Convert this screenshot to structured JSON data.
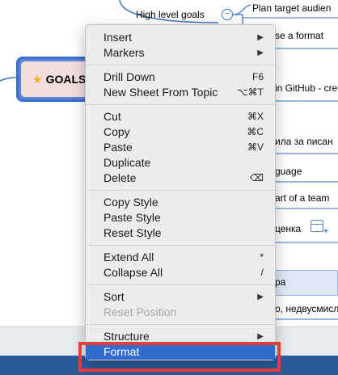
{
  "mindmap": {
    "central_topic": "GOALS",
    "high_level_goals": "High level goals",
    "collapse_symbol": "−",
    "right_topics": [
      "Plan target audien",
      "se a format",
      "in GitHub - cre",
      "ила за писан",
      "guage",
      "art of a team",
      "ценка",
      "ра",
      "о, недвусмисл"
    ]
  },
  "context_menu": {
    "groups": [
      [
        {
          "label": "Insert",
          "shortcut": "",
          "submenu": true,
          "disabled": false
        },
        {
          "label": "Markers",
          "shortcut": "",
          "submenu": true,
          "disabled": false
        }
      ],
      [
        {
          "label": "Drill Down",
          "shortcut": "F6",
          "submenu": false,
          "disabled": false
        },
        {
          "label": "New Sheet From Topic",
          "shortcut": "⌥⌘T",
          "submenu": false,
          "disabled": false
        }
      ],
      [
        {
          "label": "Cut",
          "shortcut": "⌘X",
          "submenu": false,
          "disabled": false
        },
        {
          "label": "Copy",
          "shortcut": "⌘C",
          "submenu": false,
          "disabled": false
        },
        {
          "label": "Paste",
          "shortcut": "⌘V",
          "submenu": false,
          "disabled": false
        },
        {
          "label": "Duplicate",
          "shortcut": "",
          "submenu": false,
          "disabled": false
        },
        {
          "label": "Delete",
          "shortcut": "⌫",
          "submenu": false,
          "disabled": false
        }
      ],
      [
        {
          "label": "Copy Style",
          "shortcut": "",
          "submenu": false,
          "disabled": false
        },
        {
          "label": "Paste Style",
          "shortcut": "",
          "submenu": false,
          "disabled": false
        },
        {
          "label": "Reset Style",
          "shortcut": "",
          "submenu": false,
          "disabled": false
        }
      ],
      [
        {
          "label": "Extend All",
          "shortcut": "*",
          "submenu": false,
          "disabled": false
        },
        {
          "label": "Collapse All",
          "shortcut": "/",
          "submenu": false,
          "disabled": false
        }
      ],
      [
        {
          "label": "Sort",
          "shortcut": "",
          "submenu": true,
          "disabled": false
        },
        {
          "label": "Reset Position",
          "shortcut": "",
          "submenu": false,
          "disabled": true
        }
      ],
      [
        {
          "label": "Structure",
          "shortcut": "",
          "submenu": true,
          "disabled": false
        },
        {
          "label": "Format",
          "shortcut": "",
          "submenu": false,
          "disabled": false,
          "active": true
        }
      ]
    ],
    "submenu_arrow": "▶"
  },
  "colors": {
    "accent": "#2f6ccd",
    "highlight_frame": "#e83a3a",
    "central_border": "#3d6dcf",
    "central_fill": "#f3dede"
  }
}
